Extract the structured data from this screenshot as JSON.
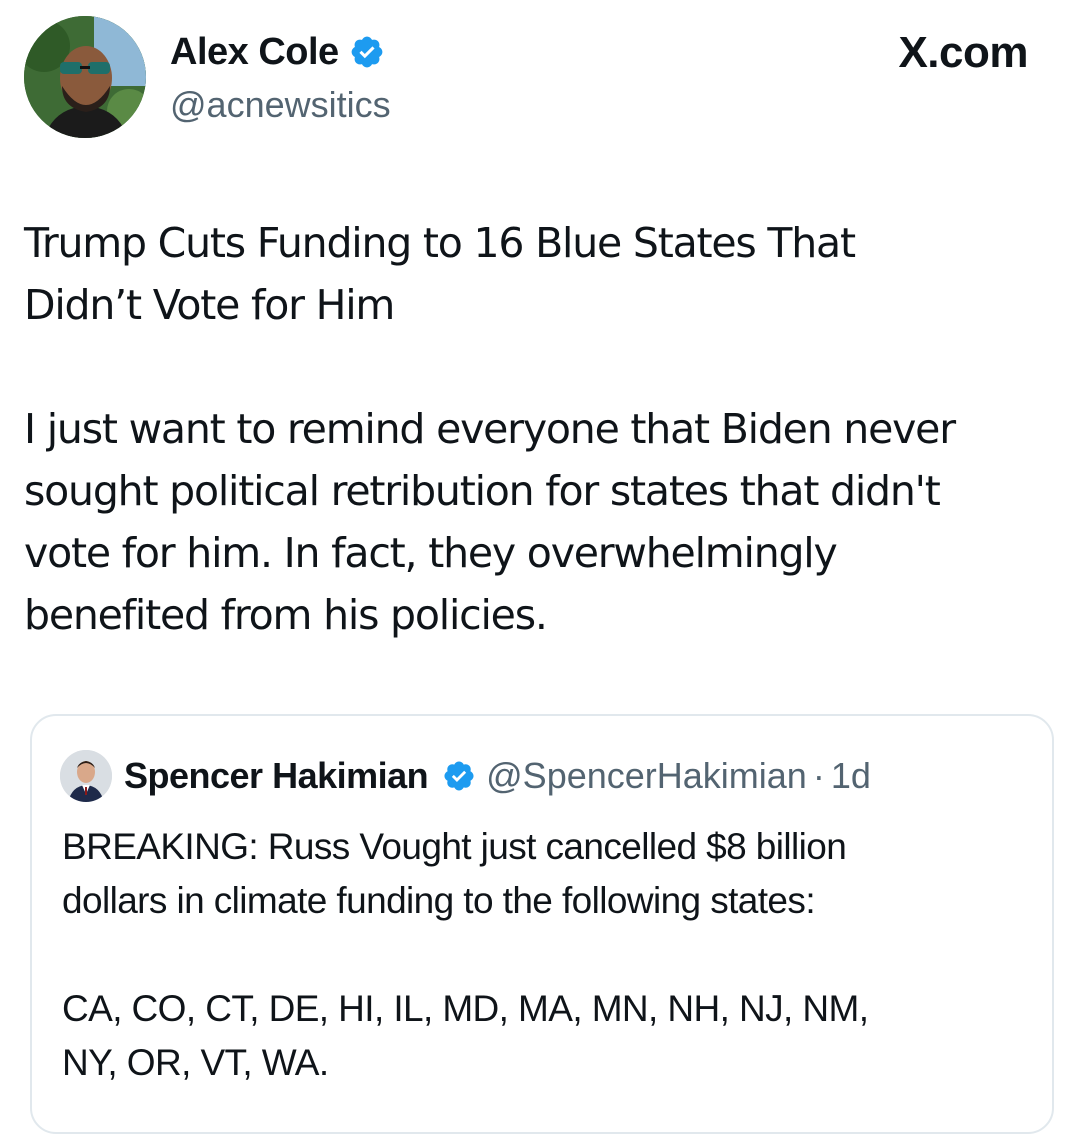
{
  "author": {
    "name": "Alex Cole",
    "handle": "@acnewsitics",
    "verified": true,
    "avatar_icon": "profile-photo-avatar"
  },
  "site_label": "X.com",
  "tweet": {
    "text": "Trump Cuts Funding to 16 Blue States That\nDidn’t Vote for Him\n\nI just want to remind everyone that Biden never\nsought political retribution for states that didn't\nvote for him. In fact, they overwhelmingly\nbenefited from his policies."
  },
  "quoted_tweet": {
    "name": "Spencer Hakimian",
    "handle": "@SpencerHakimian",
    "separator": "·",
    "time": "1d",
    "verified": true,
    "text": "BREAKING: Russ Vought just cancelled $8 billion\ndollars in climate funding to the following states:\n\nCA, CO, CT, DE, HI, IL, MD, MA, MN, NH, NJ, NM,\nNY, OR, VT, WA."
  },
  "colors": {
    "verified_blue": "#1d9bf0",
    "secondary_text": "#536471",
    "border": "#e1e8ed"
  }
}
